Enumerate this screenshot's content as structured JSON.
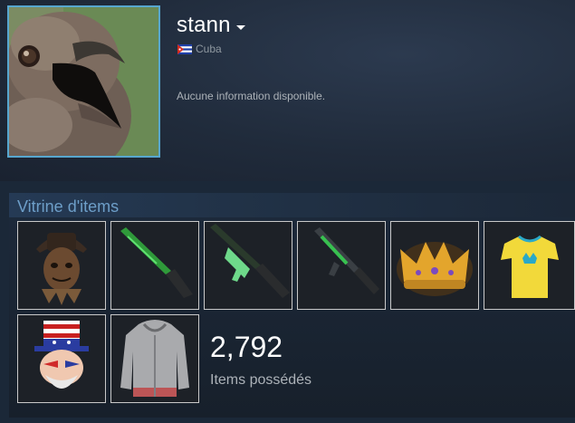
{
  "profile": {
    "persona_name": "stann",
    "country": "Cuba",
    "summary": "Aucune information disponible."
  },
  "showcase": {
    "title": "Vitrine d'items",
    "items": [
      {
        "icon": "scarecrow-mask-icon"
      },
      {
        "icon": "green-shotgun-icon"
      },
      {
        "icon": "green-rifle-icon"
      },
      {
        "icon": "green-carbine-icon"
      },
      {
        "icon": "gold-crown-icon"
      },
      {
        "icon": "yellow-tshirt-icon"
      },
      {
        "icon": "uncle-sam-mask-icon"
      },
      {
        "icon": "grey-hoodie-icon"
      }
    ],
    "item_count": "2,792",
    "item_count_label": "Items possédés"
  },
  "colors": {
    "accent": "#57a7cf",
    "showcase_title": "#6d9ec8",
    "background": "#1b2838"
  }
}
